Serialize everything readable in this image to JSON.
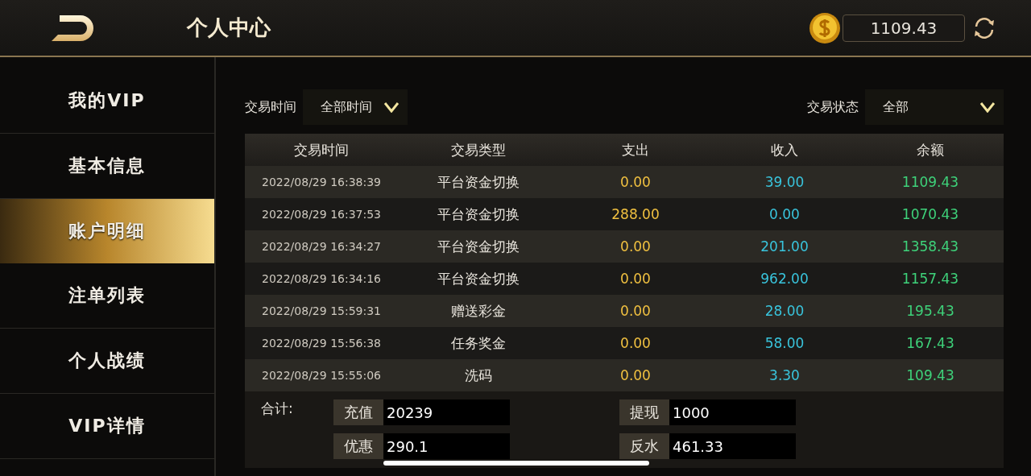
{
  "header": {
    "title": "个人中心",
    "balance": "1109.43"
  },
  "sidebar": {
    "items": [
      {
        "label": "我的VIP",
        "selected": false
      },
      {
        "label": "基本信息",
        "selected": false
      },
      {
        "label": "账户明细",
        "selected": true
      },
      {
        "label": "注单列表",
        "selected": false
      },
      {
        "label": "个人战绩",
        "selected": false
      },
      {
        "label": "VIP详情",
        "selected": false
      }
    ]
  },
  "filters": [
    {
      "label": "交易时间",
      "value": "全部时间"
    },
    {
      "label": "交易状态",
      "value": "全部"
    }
  ],
  "table": {
    "columns": [
      "交易时间",
      "交易类型",
      "支出",
      "收入",
      "余额"
    ],
    "rows": [
      [
        "2022/08/29 16:38:39",
        "平台资金切换",
        "0.00",
        "39.00",
        "1109.43"
      ],
      [
        "2022/08/29 16:37:53",
        "平台资金切换",
        "288.00",
        "0.00",
        "1070.43"
      ],
      [
        "2022/08/29 16:34:27",
        "平台资金切换",
        "0.00",
        "201.00",
        "1358.43"
      ],
      [
        "2022/08/29 16:34:16",
        "平台资金切换",
        "0.00",
        "962.00",
        "1157.43"
      ],
      [
        "2022/08/29 15:59:31",
        "赠送彩金",
        "0.00",
        "28.00",
        "195.43"
      ],
      [
        "2022/08/29 15:56:38",
        "任务奖金",
        "0.00",
        "58.00",
        "167.43"
      ],
      [
        "2022/08/29 15:55:06",
        "洗码",
        "0.00",
        "3.30",
        "109.43"
      ]
    ]
  },
  "totals": {
    "label": "合计:",
    "items": [
      {
        "label": "充值",
        "value": "20239"
      },
      {
        "label": "提现",
        "value": "1000"
      },
      {
        "label": "优惠",
        "value": "290.1"
      },
      {
        "label": "反水",
        "value": "461.33"
      }
    ]
  }
}
